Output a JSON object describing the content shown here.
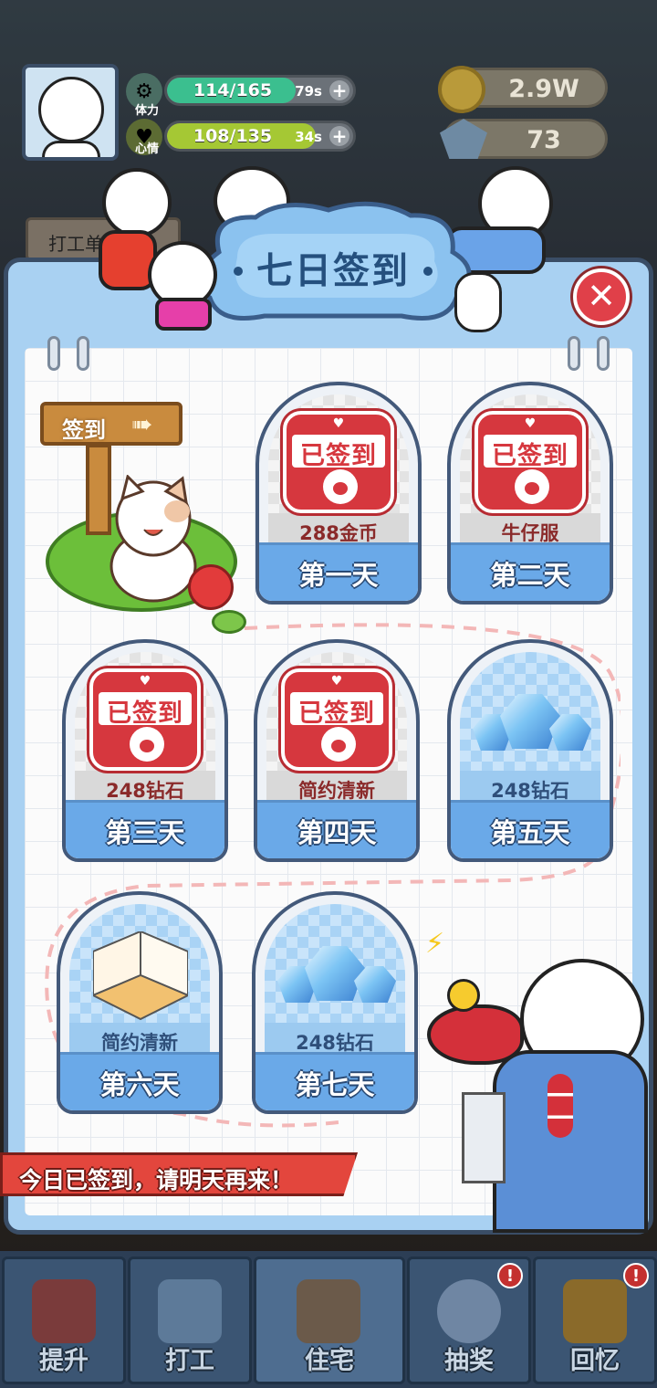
{
  "hud": {
    "stamina": {
      "label": "体力",
      "value": "114/165",
      "timer": "79s",
      "fill": 0.69,
      "color": "#3bbf8f"
    },
    "mood": {
      "label": "心情",
      "value": "108/135",
      "timer": "34s",
      "fill": 0.8,
      "color": "#a5c834"
    },
    "coins": "2.9W",
    "gems": "73",
    "work_button": "打工单"
  },
  "dialog": {
    "title": "七日签到",
    "close_icon": "close-icon",
    "signpost": "签到",
    "days": [
      {
        "day": "第一天",
        "reward": "288金币",
        "status": "已签到"
      },
      {
        "day": "第二天",
        "reward": "牛仔服",
        "status": "已签到"
      },
      {
        "day": "第三天",
        "reward": "248钻石",
        "status": "已签到"
      },
      {
        "day": "第四天",
        "reward": "简约清新",
        "status": "已签到"
      },
      {
        "day": "第五天",
        "reward": "248钻石",
        "status": ""
      },
      {
        "day": "第六天",
        "reward": "简约清新",
        "status": ""
      },
      {
        "day": "第七天",
        "reward": "248钻石",
        "status": ""
      }
    ],
    "banner": "今日已签到，请明天再来！"
  },
  "bottom_nav": [
    {
      "label": "提升",
      "badge": "",
      "icon": "book-icon"
    },
    {
      "label": "打工",
      "badge": "",
      "icon": "work-icon"
    },
    {
      "label": "住宅",
      "badge": "",
      "icon": "house-icon"
    },
    {
      "label": "抽奖",
      "badge": "!",
      "icon": "gacha-icon"
    },
    {
      "label": "回忆",
      "badge": "!",
      "icon": "camera-icon"
    }
  ],
  "colors": {
    "stamp_red": "#d6373e",
    "panel_blue": "#a9d1f2",
    "day_blue": "#6aa9e8",
    "banner_red": "#e3463d"
  }
}
